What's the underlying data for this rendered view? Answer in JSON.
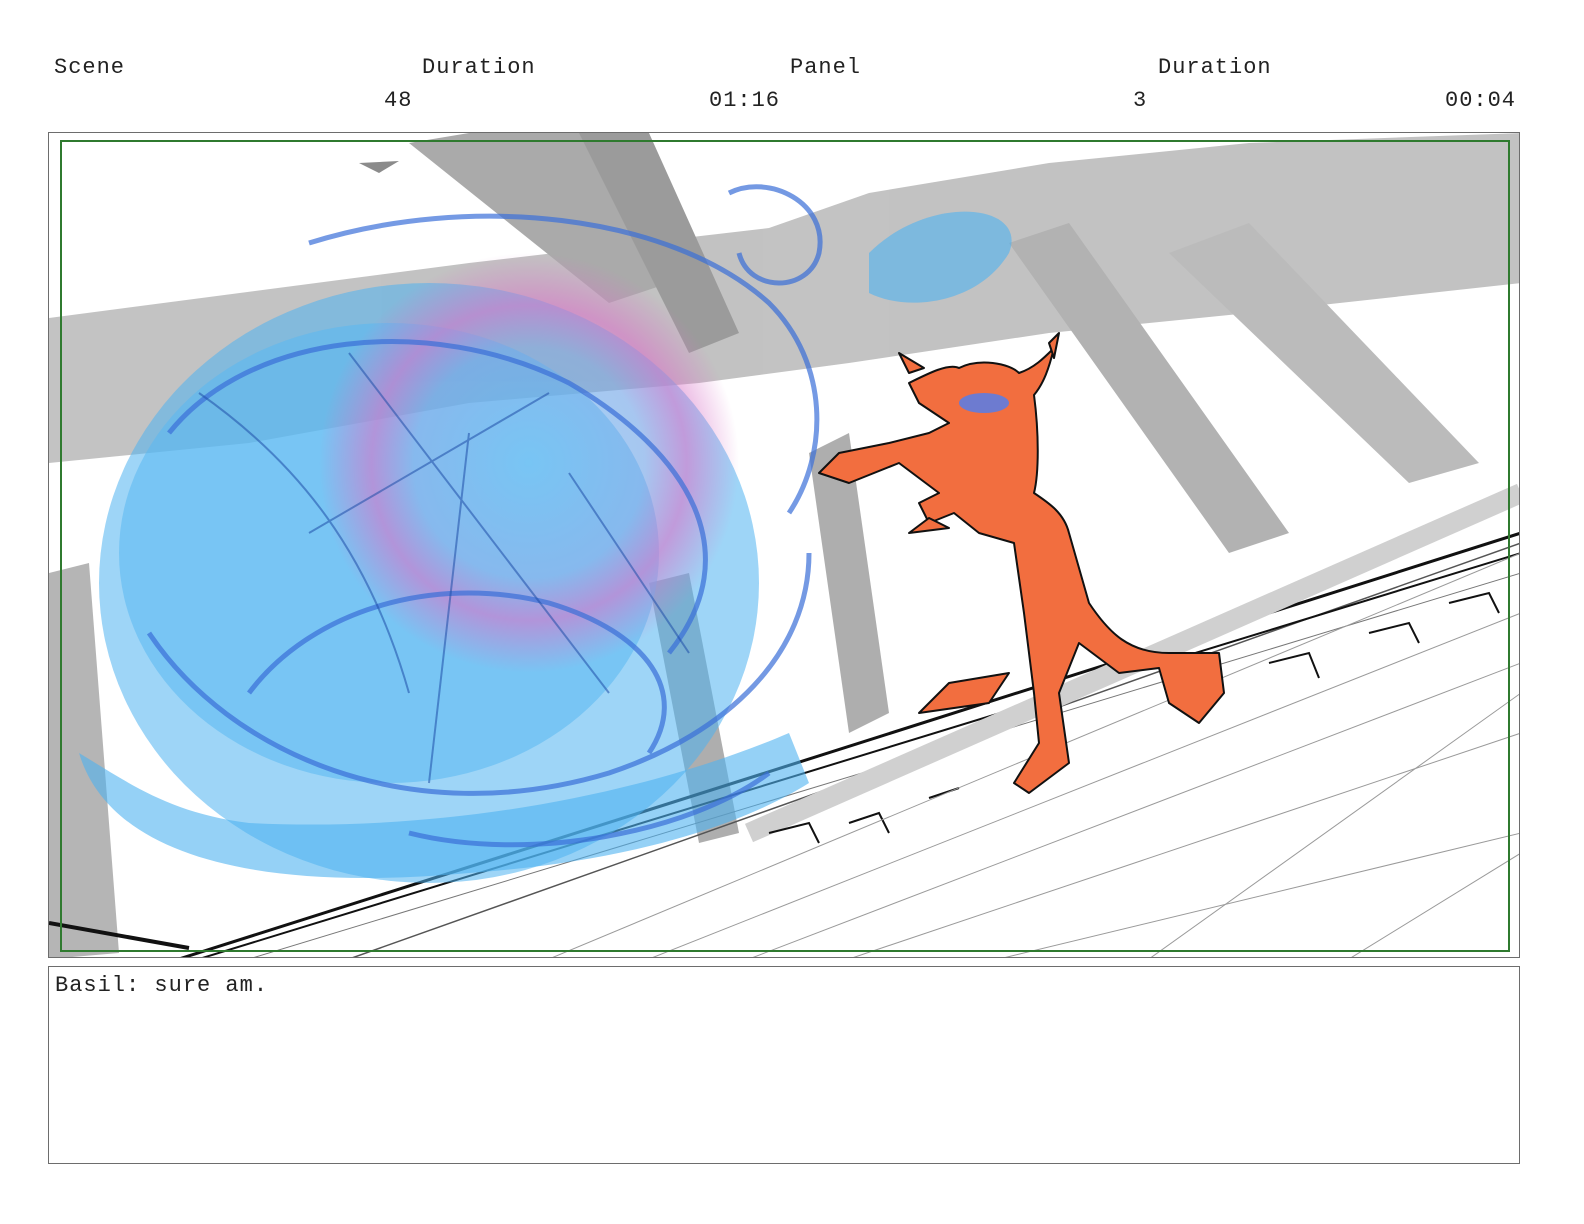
{
  "header": {
    "scene_label": "Scene",
    "duration_label_1": "Duration",
    "panel_label": "Panel",
    "duration_label_2": "Duration",
    "scene_value": "48",
    "scene_duration_value": "01:16",
    "panel_value": "3",
    "panel_duration_value": "00:04"
  },
  "panel": {
    "image": "storyboard-sketch-energy-blast-orange-creature",
    "colors": {
      "blast_blue": "#4fb3f0",
      "blast_dark": "#3a6fd8",
      "glow_pink": "#d874c8",
      "creature_orange": "#f26e3f",
      "frame_green": "#2f7a2f"
    }
  },
  "dialog": {
    "text": "Basil: sure am."
  }
}
